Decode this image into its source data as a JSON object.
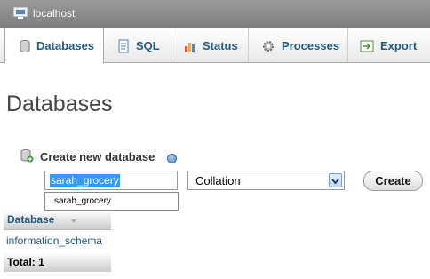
{
  "server": {
    "label": "localhost",
    "icon": "server-icon"
  },
  "tabs": [
    {
      "label": "Databases",
      "icon": "database-icon",
      "active": true
    },
    {
      "label": "SQL",
      "icon": "sql-icon"
    },
    {
      "label": "Status",
      "icon": "status-icon"
    },
    {
      "label": "Processes",
      "icon": "processes-icon"
    },
    {
      "label": "Export",
      "icon": "export-icon"
    }
  ],
  "page": {
    "title": "Databases"
  },
  "create_db": {
    "label": "Create new database",
    "input_value": "sarah_grocery",
    "autocomplete_suggestion": "sarah_grocery",
    "collation_selected": "Collation",
    "button_label": "Create"
  },
  "db_table": {
    "header": "Database",
    "rows": [
      "information_schema"
    ],
    "total_label": "Total: 1"
  },
  "colors": {
    "link": "#235a81",
    "selection": "#3399ff"
  }
}
